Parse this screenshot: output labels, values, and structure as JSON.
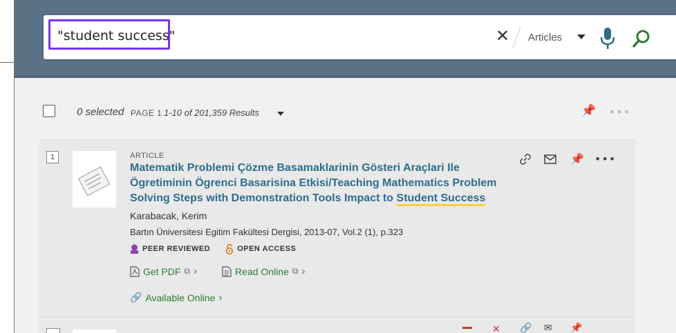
{
  "search": {
    "query": "\"student success\"",
    "scope": "Articles"
  },
  "toolbar": {
    "selected": "0 selected",
    "page": "PAGE 1",
    "range": "1-10 of 201,359 Results"
  },
  "results": [
    {
      "number": "1",
      "type": "ARTICLE",
      "title_part1": "Matematik Problemi Çözme Basamaklarinin Gösteri Araçlari Ile Ögretiminin Ögrenci Basarisina Etkisi/Teaching Mathematics Problem Solving Steps with Demonstration Tools Impact to ",
      "title_highlight": "Student Success",
      "author": "Karabacak, Kerim",
      "source": "Bartın Üniversitesi Egitim Fakültesi Dergisi, 2013-07, Vol.2 (1), p.323",
      "badges": [
        "PEER REVIEWED",
        "OPEN ACCESS"
      ],
      "links": [
        "Get PDF",
        "Read Online"
      ],
      "availability": "Available Online"
    }
  ],
  "colors": {
    "header_bg": "#5b7185",
    "highlight_border": "#7b2ff7",
    "title_link": "#2e6d8d",
    "green_link": "#2e7d32",
    "peer_reviewed": "#8e44ad",
    "open_access": "#e67e22"
  }
}
